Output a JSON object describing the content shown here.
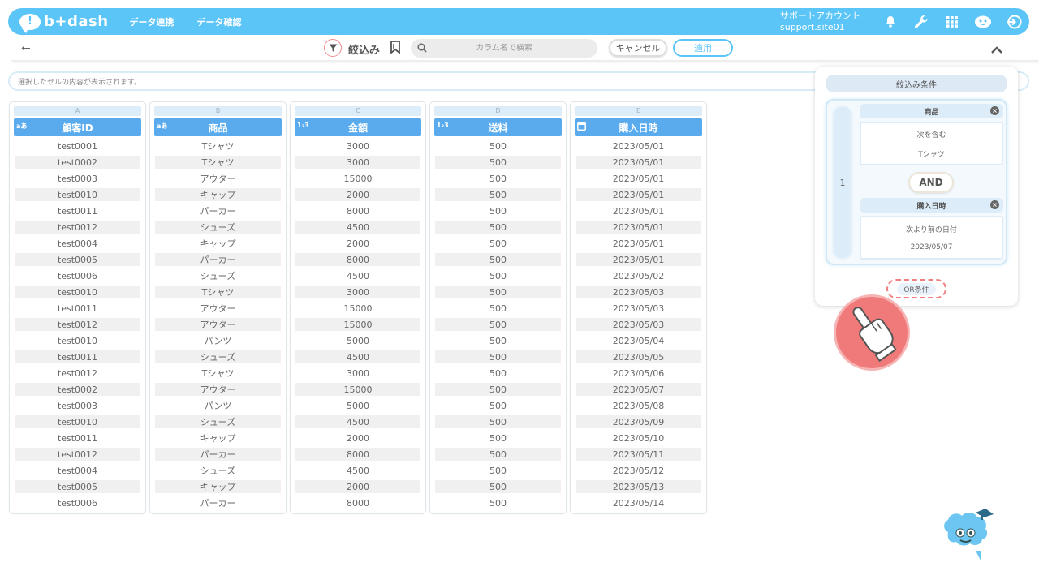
{
  "header": {
    "logo_text": "b+dash",
    "logo_mark": "!",
    "nav": [
      "データ連携",
      "データ確認"
    ],
    "account_line1": "サポートアカウント",
    "account_line2": "support.site01",
    "icons": [
      "bell-icon",
      "wrench-icon",
      "grid-icon",
      "mascot-icon",
      "logout-icon"
    ],
    "accent_color": "#5cc5f7"
  },
  "toolbar": {
    "back": "←",
    "filter_label": "絞込み",
    "search_placeholder": "カラム名で検索",
    "cancel_label": "キャンセル",
    "apply_label": "適用"
  },
  "cell_bar": {
    "placeholder": "選択したセルの内容が表示されます。"
  },
  "table": {
    "columns": [
      {
        "letter": "A",
        "type": "aあ",
        "name": "顧客ID"
      },
      {
        "letter": "B",
        "type": "aあ",
        "name": "商品"
      },
      {
        "letter": "C",
        "type": "1₂3",
        "name": "金額"
      },
      {
        "letter": "D",
        "type": "1₂3",
        "name": "送料"
      },
      {
        "letter": "E",
        "type": "calendar-icon",
        "name": "購入日時"
      }
    ],
    "rows": [
      [
        "test0001",
        "Tシャツ",
        "3000",
        "500",
        "2023/05/01"
      ],
      [
        "test0002",
        "Tシャツ",
        "3000",
        "500",
        "2023/05/01"
      ],
      [
        "test0003",
        "アウター",
        "15000",
        "500",
        "2023/05/01"
      ],
      [
        "test0010",
        "キャップ",
        "2000",
        "500",
        "2023/05/01"
      ],
      [
        "test0011",
        "パーカー",
        "8000",
        "500",
        "2023/05/01"
      ],
      [
        "test0012",
        "シューズ",
        "4500",
        "500",
        "2023/05/01"
      ],
      [
        "test0004",
        "キャップ",
        "2000",
        "500",
        "2023/05/01"
      ],
      [
        "test0005",
        "パーカー",
        "8000",
        "500",
        "2023/05/01"
      ],
      [
        "test0006",
        "シューズ",
        "4500",
        "500",
        "2023/05/02"
      ],
      [
        "test0010",
        "Tシャツ",
        "3000",
        "500",
        "2023/05/03"
      ],
      [
        "test0011",
        "アウター",
        "15000",
        "500",
        "2023/05/03"
      ],
      [
        "test0012",
        "アウター",
        "15000",
        "500",
        "2023/05/03"
      ],
      [
        "test0010",
        "パンツ",
        "5000",
        "500",
        "2023/05/04"
      ],
      [
        "test0011",
        "シューズ",
        "4500",
        "500",
        "2023/05/05"
      ],
      [
        "test0012",
        "Tシャツ",
        "3000",
        "500",
        "2023/05/06"
      ],
      [
        "test0002",
        "アウター",
        "15000",
        "500",
        "2023/05/07"
      ],
      [
        "test0003",
        "パンツ",
        "5000",
        "500",
        "2023/05/08"
      ],
      [
        "test0010",
        "シューズ",
        "4500",
        "500",
        "2023/05/09"
      ],
      [
        "test0011",
        "キャップ",
        "2000",
        "500",
        "2023/05/10"
      ],
      [
        "test0012",
        "パーカー",
        "8000",
        "500",
        "2023/05/11"
      ],
      [
        "test0004",
        "シューズ",
        "4500",
        "500",
        "2023/05/12"
      ],
      [
        "test0005",
        "キャップ",
        "2000",
        "500",
        "2023/05/13"
      ],
      [
        "test0006",
        "パーカー",
        "8000",
        "500",
        "2023/05/14"
      ]
    ]
  },
  "filter_panel": {
    "title": "絞込み条件",
    "group_index": "1",
    "conditions": [
      {
        "column": "商品",
        "operator": "次を含む",
        "value": "Tシャツ"
      },
      {
        "column": "購入日時",
        "operator": "次より前の日付",
        "value": "2023/05/07"
      }
    ],
    "and_label": "AND",
    "or_label": "OR条件",
    "remove_glyph": "×"
  }
}
